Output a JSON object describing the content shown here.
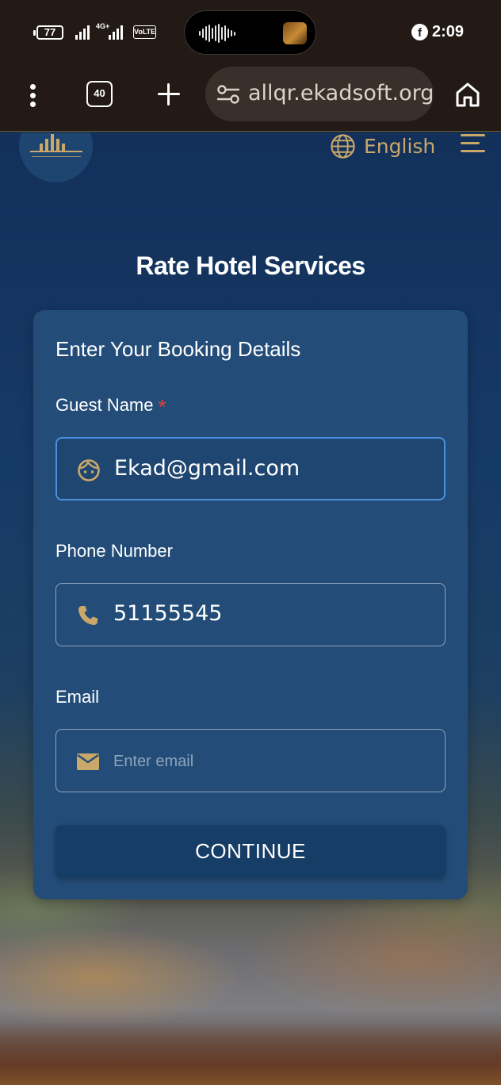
{
  "status_bar": {
    "battery": "77",
    "network": "4G+",
    "volte": "VoLTE",
    "time": "2:09",
    "facebook_icon": "facebook-icon"
  },
  "browser": {
    "tab_count": "40",
    "url": "allqr.ekadsoft.org",
    "icons": [
      "menu-dots-icon",
      "tabs-icon",
      "plus-icon",
      "site-settings-icon",
      "home-icon"
    ]
  },
  "header": {
    "language": "English",
    "icons": [
      "globe-icon",
      "hamburger-icon"
    ]
  },
  "page": {
    "title": "Rate Hotel Services"
  },
  "form": {
    "heading": "Enter Your Booking Details",
    "guest_name": {
      "label": "Guest Name",
      "required_mark": "*",
      "value": "Ekad@gmail.com",
      "icon": "face-icon"
    },
    "phone": {
      "label": "Phone Number",
      "value": "51155545",
      "icon": "phone-icon"
    },
    "email": {
      "label": "Email",
      "placeholder": "Enter email",
      "icon": "mail-icon"
    },
    "submit_label": "CONTINUE"
  },
  "colors": {
    "accent_gold": "#c9a86a",
    "card": "#234d78",
    "focus": "#4a8fe0",
    "required": "#e0433a"
  }
}
